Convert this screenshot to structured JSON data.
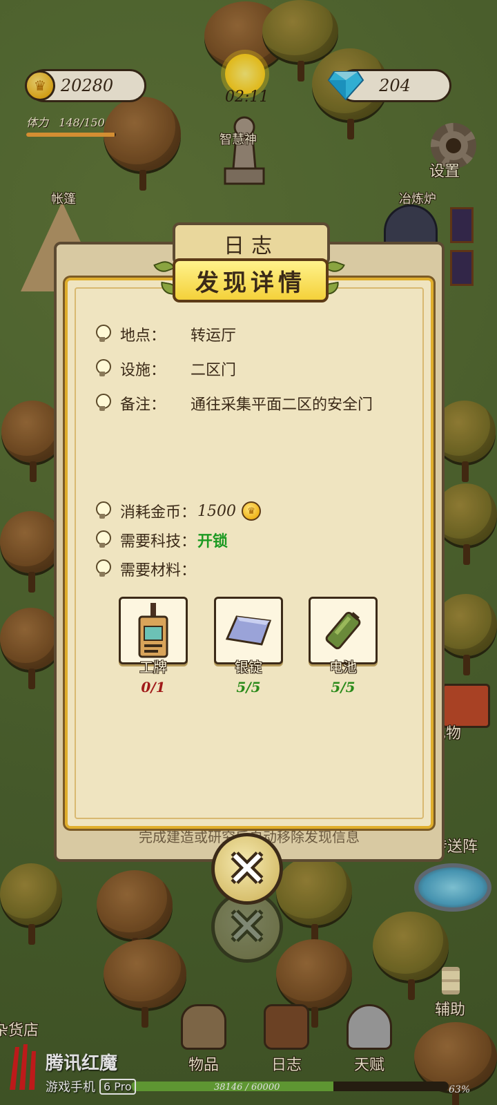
{
  "hud": {
    "gold": "20280",
    "gems": "204",
    "stamina_label": "体力",
    "stamina_value": "148/150",
    "stamina_fraction": 0.987,
    "clock": "02:11"
  },
  "map_labels": {
    "wisdom_god": "智慧神",
    "tent": "帐篷",
    "furnace": "冶炼炉",
    "settings": "设置",
    "gift": "礼物",
    "portal": "传送阵",
    "assist": "辅助",
    "shop": "杂货店"
  },
  "dialog": {
    "back_title": "日志",
    "title": "发现详情",
    "location_key": "地点：",
    "location_value": "转运厅",
    "facility_key": "设施：",
    "facility_value": "二区门",
    "note_key": "备注：",
    "note_value": "通往采集平面二区的安全门",
    "cost_key": "消耗金币：",
    "cost_value": "1500",
    "tech_key": "需要科技：",
    "tech_value": "开锁",
    "materials_key": "需要材料：",
    "materials": [
      {
        "name": "工牌",
        "count": "0/1",
        "icon": "badge-icon"
      },
      {
        "name": "银锭",
        "count": "5/5",
        "icon": "silver-ingot-icon"
      },
      {
        "name": "电池",
        "count": "5/5",
        "icon": "battery-icon"
      }
    ],
    "hint": "完成建造或研究后自动移除发现信息"
  },
  "nav": {
    "items": "物品",
    "log": "日志",
    "talent": "天赋"
  },
  "xp": {
    "text": "38146 / 60000",
    "fraction": 0.636,
    "percent": "63%"
  },
  "branding": {
    "name": "腾讯红魔",
    "sub": "游戏手机",
    "badge": "6 Pro"
  },
  "colors": {
    "accent": "#f4d13a",
    "missing": "#a01a1a",
    "enough": "#2a8a1a",
    "tech_ok": "#1c9a22"
  }
}
